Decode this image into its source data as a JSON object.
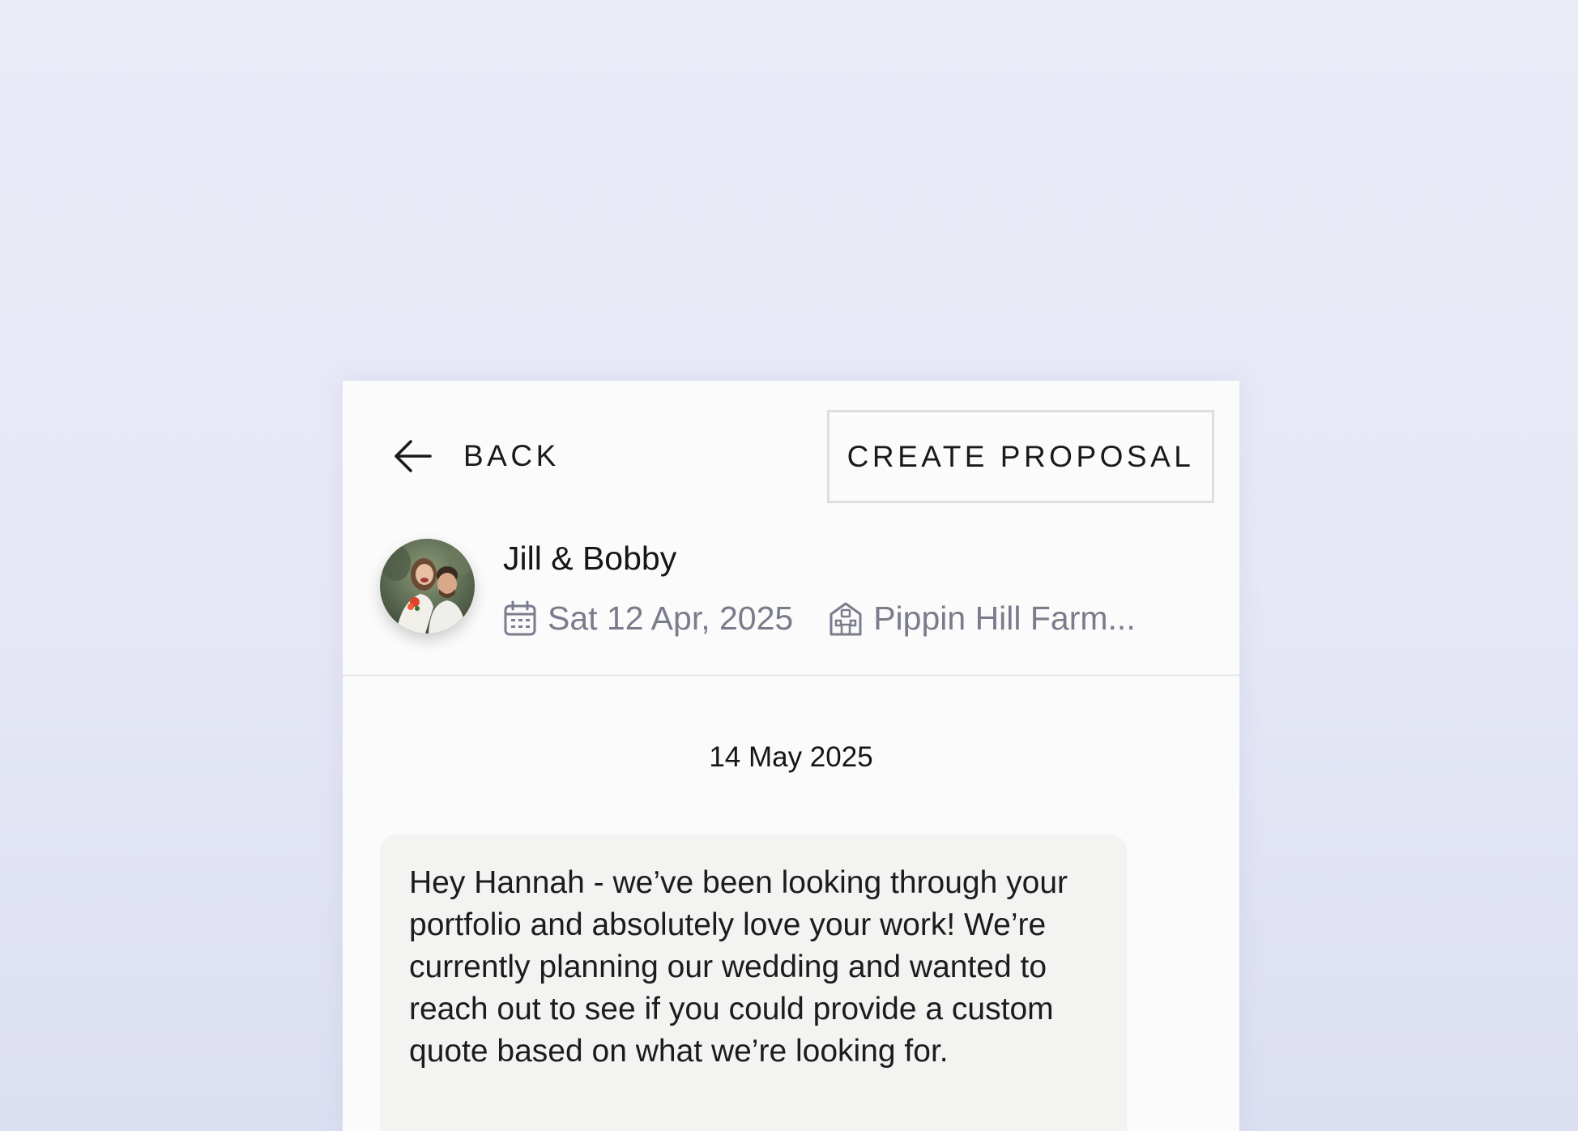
{
  "header": {
    "back_label": "BACK",
    "create_proposal_label": "CREATE PROPOSAL"
  },
  "client": {
    "name": "Jill & Bobby",
    "event_date": "Sat 12 Apr, 2025",
    "venue": "Pippin Hill Farm...",
    "avatar_icon": "couple-photo-avatar",
    "date_icon": "calendar-icon",
    "venue_icon": "building-icon"
  },
  "conversation": {
    "day_label": "14 May 2025",
    "messages": [
      {
        "text": "Hey Hannah - we’ve been looking through your portfolio and absolutely love your work! We’re currently planning our wedding and wanted to reach out to see if you could provide a custom quote based on what we’re looking for."
      }
    ]
  },
  "colors": {
    "background": "#e8eaf7",
    "card": "#fbfbfb",
    "message_bubble": "#f3f3f2",
    "muted_text": "#7a7c8c",
    "primary_text": "#1a1a1a"
  }
}
